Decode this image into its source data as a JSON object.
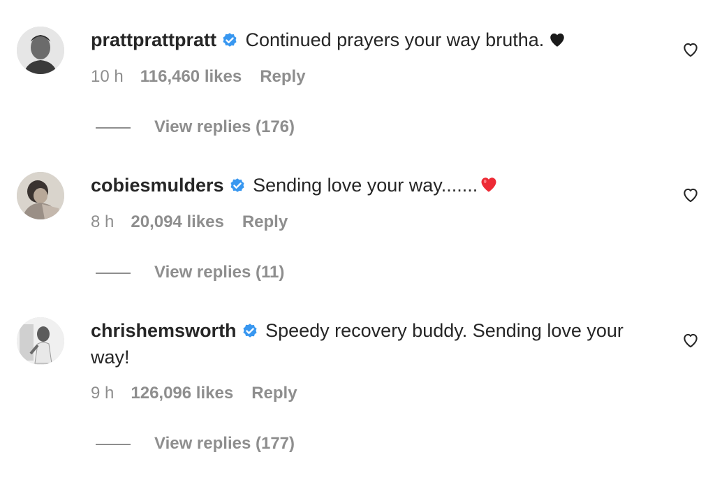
{
  "colors": {
    "text_primary": "#262626",
    "text_secondary": "#8e8e8e",
    "verified_blue": "#3897f0",
    "red_heart": "#ed2a35"
  },
  "comments": [
    {
      "username": "prattprattpratt",
      "verified": true,
      "text": "Continued prayers your way brutha.",
      "emoji": "black-heart-icon",
      "time": "10 h",
      "likes": "116,460 likes",
      "reply_label": "Reply",
      "view_replies": "View replies (176)"
    },
    {
      "username": "cobiesmulders",
      "verified": true,
      "text": "Sending love your way.......",
      "emoji": "red-heart-icon",
      "time": "8 h",
      "likes": "20,094 likes",
      "reply_label": "Reply",
      "view_replies": "View replies (11)"
    },
    {
      "username": "chrishemsworth",
      "verified": true,
      "text": "Speedy recovery buddy. Sending love your way!",
      "emoji": "",
      "time": "9 h",
      "likes": "126,096 likes",
      "reply_label": "Reply",
      "view_replies": "View replies (177)"
    }
  ]
}
